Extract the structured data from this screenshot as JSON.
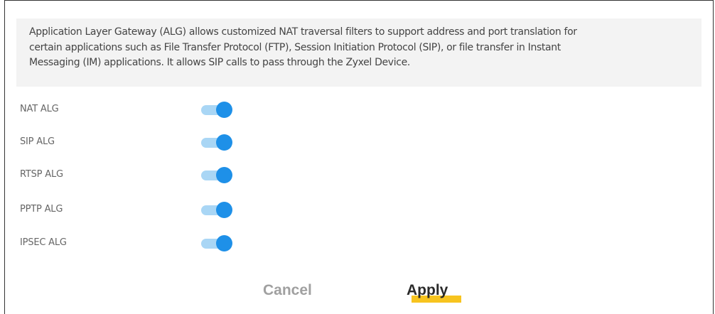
{
  "description": {
    "lines": [
      "Application Layer Gateway (ALG) allows customized NAT traversal filters to support address and port translation for",
      "certain applications such as File Transfer Protocol (FTP), Session Initiation Protocol (SIP), or file transfer in Instant",
      "Messaging (IM) applications. It allows SIP calls to pass through the Zyxel Device."
    ]
  },
  "alg_settings": [
    {
      "label": "NAT ALG",
      "enabled": true
    },
    {
      "label": "SIP ALG",
      "enabled": true
    },
    {
      "label": "RTSP ALG",
      "enabled": true
    },
    {
      "label": "PPTP ALG",
      "enabled": true
    },
    {
      "label": "IPSEC ALG",
      "enabled": true
    }
  ],
  "buttons": {
    "cancel_label": "Cancel",
    "apply_label": "Apply"
  },
  "colors": {
    "toggle_on_knob": "#1e90e8",
    "toggle_on_track": "#a9d6f5",
    "apply_accent": "#f7c41f",
    "description_bg": "#f3f3f3"
  }
}
